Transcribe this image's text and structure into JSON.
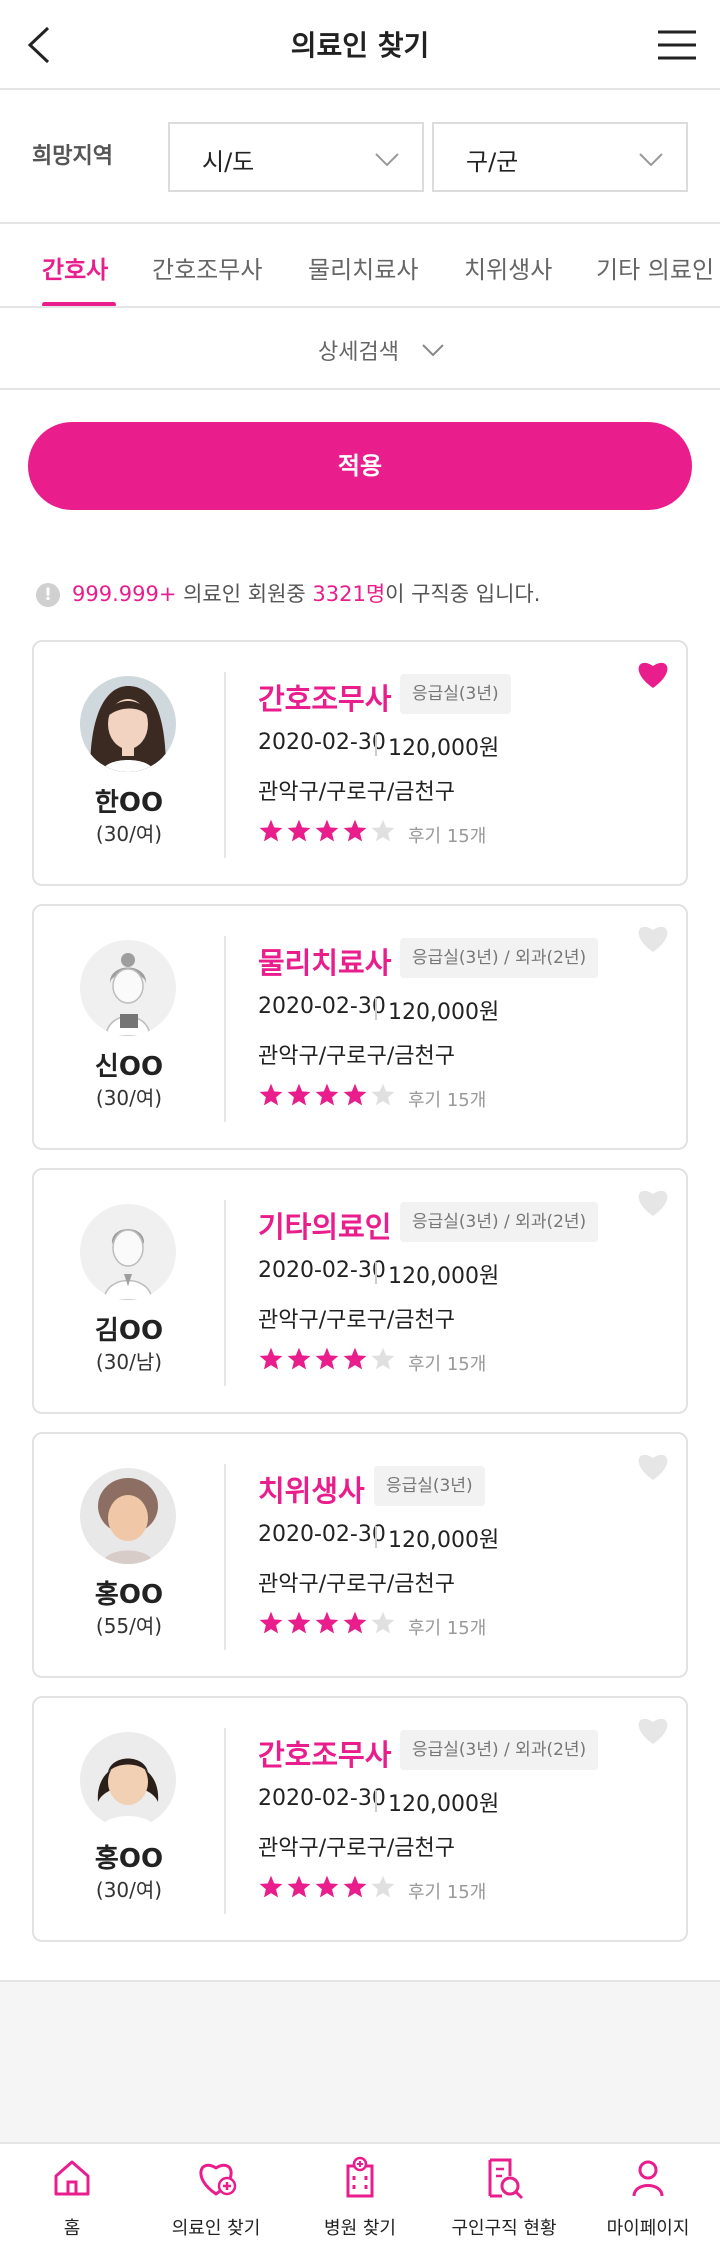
{
  "header": {
    "title": "의료인 찾기"
  },
  "region": {
    "label": "희망지역",
    "sido": "시/도",
    "gugun": "구/군"
  },
  "tabs": [
    {
      "label": "간호사",
      "active": true
    },
    {
      "label": "간호조무사",
      "active": false
    },
    {
      "label": "물리치료사",
      "active": false
    },
    {
      "label": "치위생사",
      "active": false
    },
    {
      "label": "기타 의료인",
      "active": false
    }
  ],
  "detail_search": {
    "label": "상세검색"
  },
  "apply_button": "적용",
  "info": {
    "icon": "!",
    "total": "999.999+",
    "mid": " 의료인 회원중 ",
    "seeking": "3321명",
    "tail": "이 구직중 입니다."
  },
  "accent_color": "#e91e8c",
  "members": [
    {
      "name": "한OO",
      "age": "(30/여)",
      "job": "간호조무사",
      "tag": "응급실(3년)",
      "date": "2020-02-30",
      "salary": "120,000원",
      "area": "관악구/구로구/금천구",
      "rating": 4,
      "review": "후기 15개",
      "liked": true,
      "avatar": "photo-woman"
    },
    {
      "name": "신OO",
      "age": "(30/여)",
      "job": "물리치료사",
      "tag": "응급실(3년) / 외과(2년)",
      "date": "2020-02-30",
      "salary": "120,000원",
      "area": "관악구/구로구/금천구",
      "rating": 4,
      "review": "후기 15개",
      "liked": false,
      "avatar": "illustration-woman"
    },
    {
      "name": "김OO",
      "age": "(30/남)",
      "job": "기타의료인",
      "tag": "응급실(3년) / 외과(2년)",
      "date": "2020-02-30",
      "salary": "120,000원",
      "area": "관악구/구로구/금천구",
      "rating": 4,
      "review": "후기 15개",
      "liked": false,
      "avatar": "illustration-man"
    },
    {
      "name": "홍OO",
      "age": "(55/여)",
      "job": "치위생사",
      "tag": "응급실(3년)",
      "date": "2020-02-30",
      "salary": "120,000원",
      "area": "관악구/구로구/금천구",
      "rating": 4,
      "review": "후기 15개",
      "liked": false,
      "avatar": "photo-older-woman"
    },
    {
      "name": "홍OO",
      "age": "(30/여)",
      "job": "간호조무사",
      "tag": "응급실(3년) / 외과(2년)",
      "date": "2020-02-30",
      "salary": "120,000원",
      "area": "관악구/구로구/금천구",
      "rating": 4,
      "review": "후기 15개",
      "liked": false,
      "avatar": "photo-woman-short-hair"
    }
  ],
  "bottom_nav": [
    {
      "label": "홈",
      "icon": "home-icon"
    },
    {
      "label": "의료인 찾기",
      "icon": "heart-plus-icon"
    },
    {
      "label": "병원 찾기",
      "icon": "hospital-icon"
    },
    {
      "label": "구인구직 현황",
      "icon": "document-search-icon"
    },
    {
      "label": "마이페이지",
      "icon": "person-icon"
    }
  ]
}
